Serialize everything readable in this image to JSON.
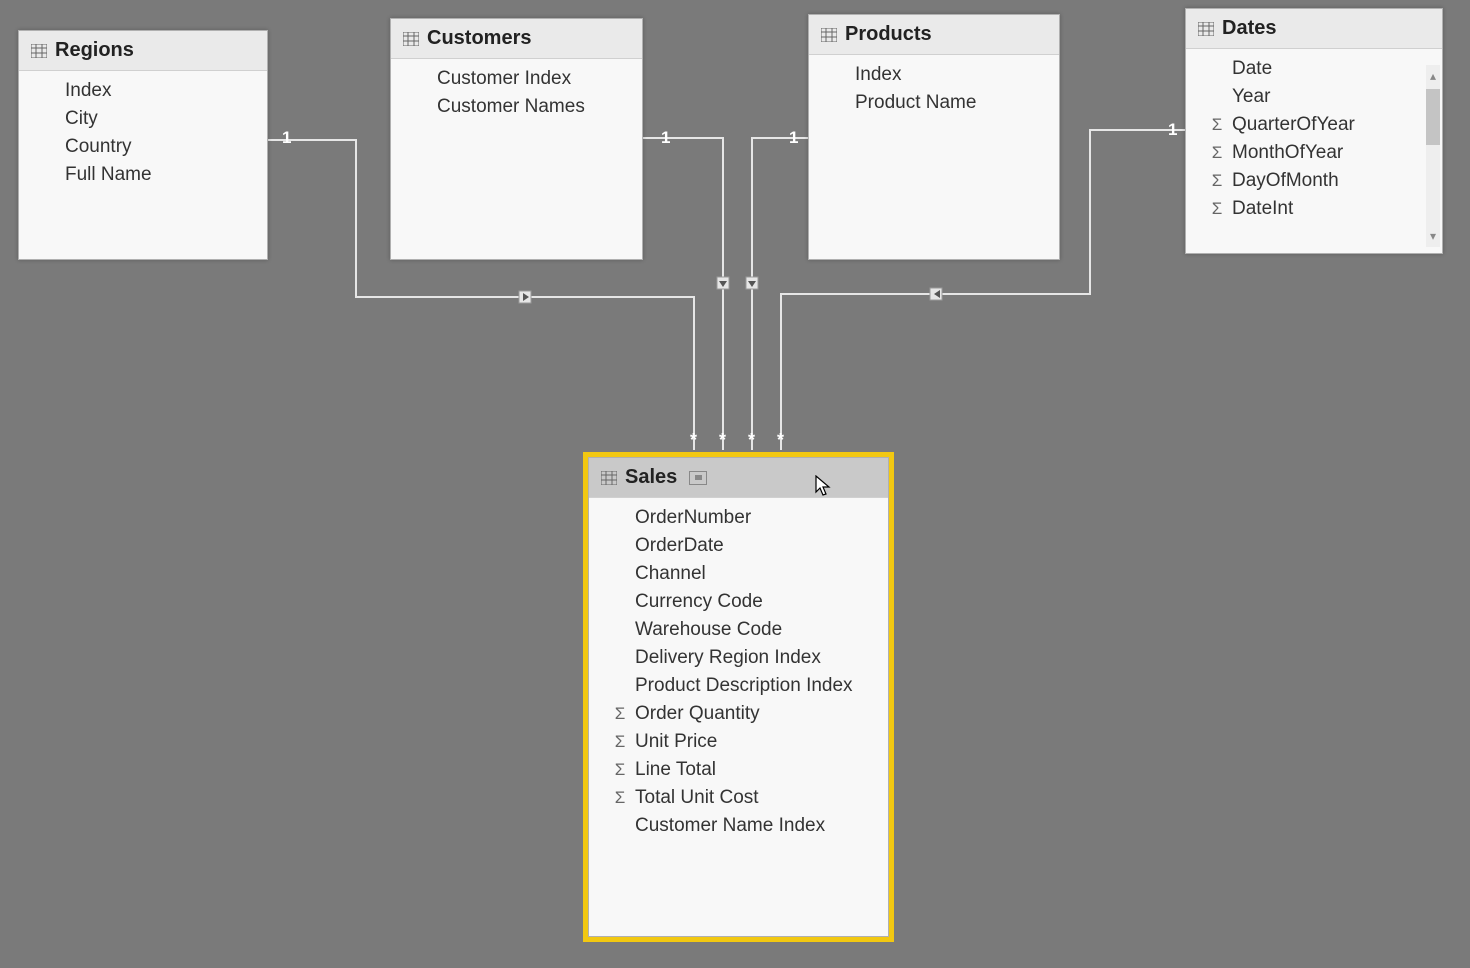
{
  "tables": {
    "regions": {
      "title": "Regions",
      "fields": [
        "Index",
        "City",
        "Country",
        "Full Name"
      ]
    },
    "customers": {
      "title": "Customers",
      "fields": [
        "Customer Index",
        "Customer Names"
      ]
    },
    "products": {
      "title": "Products",
      "fields": [
        "Index",
        "Product Name"
      ]
    },
    "dates": {
      "title": "Dates",
      "fields": [
        {
          "name": "Date",
          "agg": false
        },
        {
          "name": "Year",
          "agg": false
        },
        {
          "name": "QuarterOfYear",
          "agg": true
        },
        {
          "name": "MonthOfYear",
          "agg": true
        },
        {
          "name": "DayOfMonth",
          "agg": true
        },
        {
          "name": "DateInt",
          "agg": true
        }
      ]
    },
    "sales": {
      "title": "Sales",
      "fields": [
        {
          "name": "OrderNumber",
          "agg": false
        },
        {
          "name": "OrderDate",
          "agg": false
        },
        {
          "name": "Channel",
          "agg": false
        },
        {
          "name": "Currency Code",
          "agg": false
        },
        {
          "name": "Warehouse Code",
          "agg": false
        },
        {
          "name": "Delivery Region Index",
          "agg": false
        },
        {
          "name": "Product Description Index",
          "agg": false
        },
        {
          "name": "Order Quantity",
          "agg": true
        },
        {
          "name": "Unit Price",
          "agg": true
        },
        {
          "name": "Line Total",
          "agg": true
        },
        {
          "name": "Total Unit Cost",
          "agg": true
        },
        {
          "name": "Customer Name Index",
          "agg": false
        }
      ]
    }
  },
  "relationships": [
    {
      "from": "regions",
      "to": "sales",
      "fromCard": "1",
      "toCard": "*"
    },
    {
      "from": "customers",
      "to": "sales",
      "fromCard": "1",
      "toCard": "*"
    },
    {
      "from": "products",
      "to": "sales",
      "fromCard": "1",
      "toCard": "*"
    },
    {
      "from": "dates",
      "to": "sales",
      "fromCard": "1",
      "toCard": "*"
    }
  ],
  "sigma_glyph": "Σ"
}
